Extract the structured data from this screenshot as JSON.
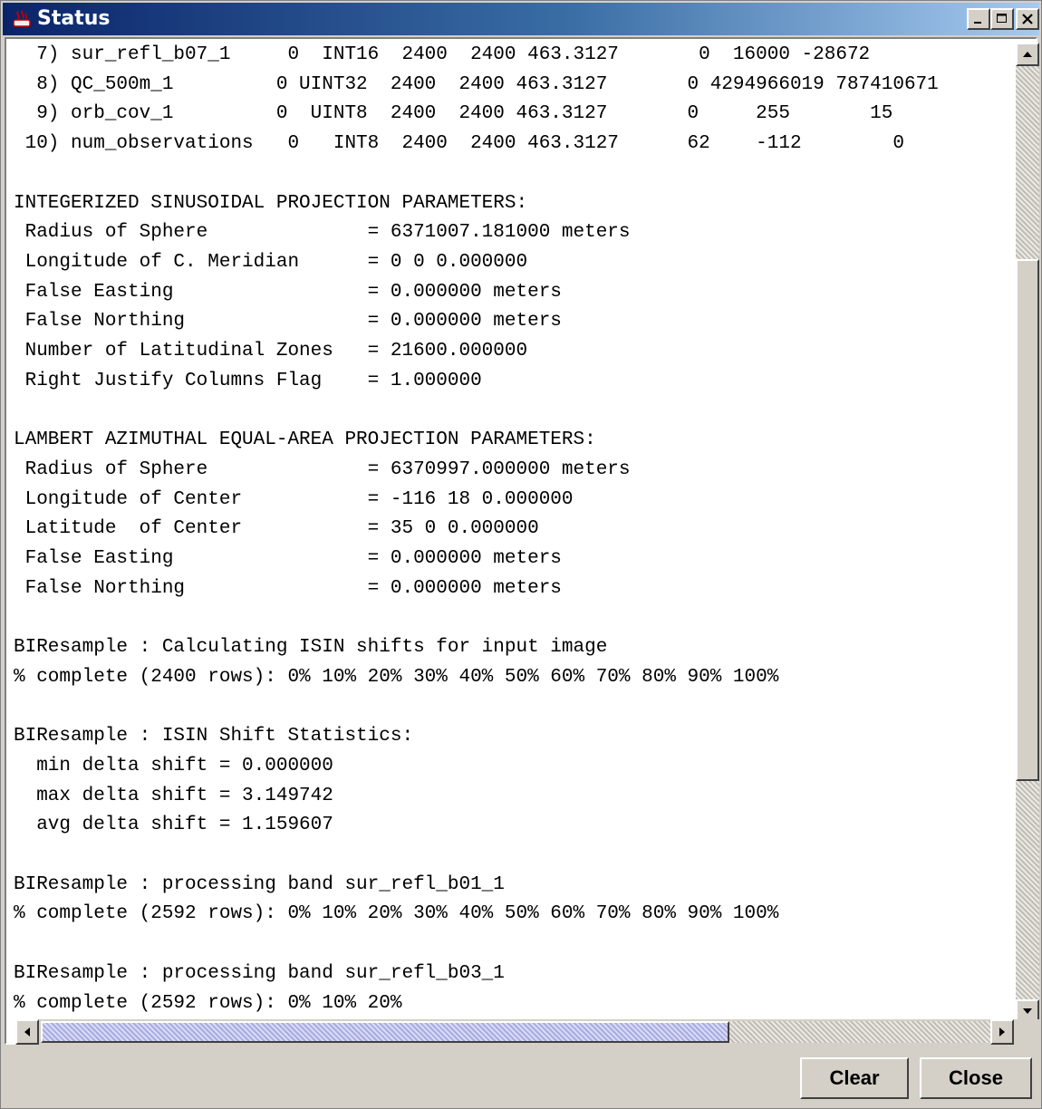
{
  "window": {
    "title": "Status",
    "app_icon": "java-app-icon",
    "controls": [
      "minimize-icon",
      "maximize-icon",
      "close-icon"
    ]
  },
  "log_lines": [
    "  7) sur_refl_b07_1     0  INT16  2400  2400 463.3127       0  16000 -28672",
    "  8) QC_500m_1         0 UINT32  2400  2400 463.3127       0 4294966019 787410671",
    "  9) orb_cov_1         0  UINT8  2400  2400 463.3127       0     255       15",
    " 10) num_observations   0   INT8  2400  2400 463.3127      62    -112        0",
    "",
    "INTEGERIZED SINUSOIDAL PROJECTION PARAMETERS:",
    " Radius of Sphere              = 6371007.181000 meters",
    " Longitude of C. Meridian      = 0 0 0.000000",
    " False Easting                 = 0.000000 meters",
    " False Northing                = 0.000000 meters",
    " Number of Latitudinal Zones   = 21600.000000",
    " Right Justify Columns Flag    = 1.000000",
    "",
    "LAMBERT AZIMUTHAL EQUAL-AREA PROJECTION PARAMETERS:",
    " Radius of Sphere              = 6370997.000000 meters",
    " Longitude of Center           = -116 18 0.000000",
    " Latitude  of Center           = 35 0 0.000000",
    " False Easting                 = 0.000000 meters",
    " False Northing                = 0.000000 meters",
    "",
    "BIResample : Calculating ISIN shifts for input image",
    "% complete (2400 rows): 0% 10% 20% 30% 40% 50% 60% 70% 80% 90% 100%",
    "",
    "BIResample : ISIN Shift Statistics:",
    "  min delta shift = 0.000000",
    "  max delta shift = 3.149742",
    "  avg delta shift = 1.159607",
    "",
    "BIResample : processing band sur_refl_b01_1",
    "% complete (2592 rows): 0% 10% 20% 30% 40% 50% 60% 70% 80% 90% 100%",
    "",
    "BIResample : processing band sur_refl_b03_1",
    "% complete (2592 rows): 0% 10% 20%"
  ],
  "scrollbars": {
    "vertical_position": 0.47,
    "horizontal_position": 0.0
  },
  "buttons": {
    "clear_label": "Clear",
    "close_label": "Close"
  }
}
